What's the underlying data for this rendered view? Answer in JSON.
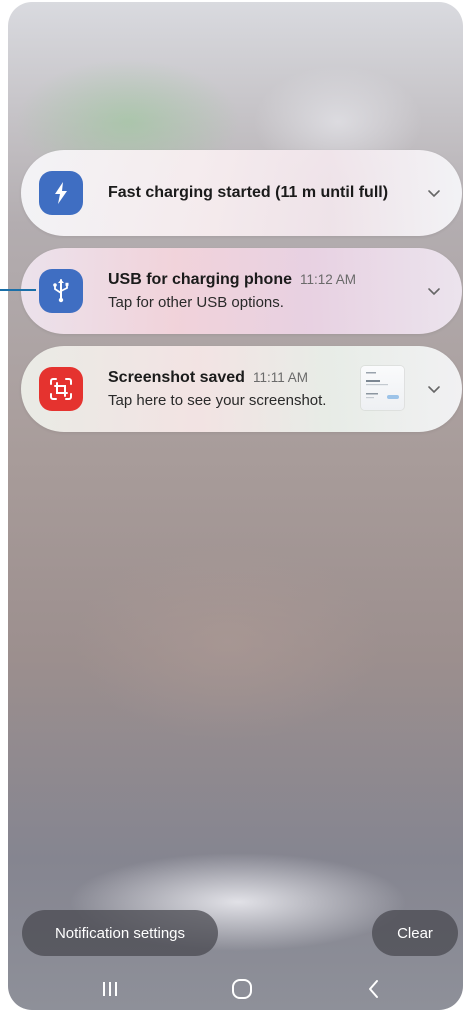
{
  "notifications": [
    {
      "icon": "lightning-bolt-icon",
      "icon_color": "#3f6ec2",
      "title": "Fast charging started (11 m until full)"
    },
    {
      "icon": "usb-icon",
      "icon_color": "#3f6ec2",
      "title": "USB for charging phone",
      "time": "11:12 AM",
      "text": "Tap for other USB options."
    },
    {
      "icon": "screenshot-icon",
      "icon_color": "#e5332f",
      "title": "Screenshot saved",
      "time": "11:11 AM",
      "text": "Tap here to see your screenshot."
    }
  ],
  "footer": {
    "settings_label": "Notification settings",
    "clear_label": "Clear"
  },
  "navbar": {
    "recents": "recents-icon",
    "home": "home-icon",
    "back": "back-icon"
  },
  "colors": {
    "callout_line": "#1a6fa8"
  }
}
